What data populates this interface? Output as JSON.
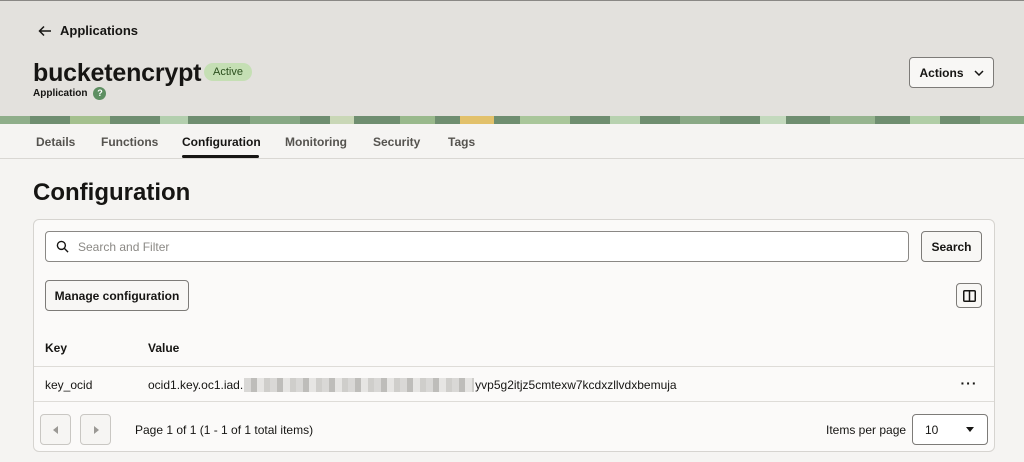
{
  "header": {
    "back_label": "Applications",
    "title": "bucketencrypt",
    "status": "Active",
    "subtitle": "Application",
    "actions_label": "Actions"
  },
  "tabs": [
    {
      "label": "Details"
    },
    {
      "label": "Functions"
    },
    {
      "label": "Configuration",
      "active": true
    },
    {
      "label": "Monitoring"
    },
    {
      "label": "Security"
    },
    {
      "label": "Tags"
    }
  ],
  "main": {
    "title": "Configuration",
    "search_placeholder": "Search and Filter",
    "search_button": "Search",
    "manage_button": "Manage configuration"
  },
  "table": {
    "columns": [
      "Key",
      "Value"
    ],
    "rows": [
      {
        "key": "key_ocid",
        "value_start": "ocid1.key.oc1.iad.",
        "value_end": "yvp5g2itjz5cmtexw7kcdxzllvdxbemuja"
      }
    ]
  },
  "pagination": {
    "page_info": "Page 1 of 1 (1 - 1 of 1 total items)",
    "items_per_page_label": "Items per page",
    "items_per_page": "10"
  },
  "colors": {
    "status_badge_bg": "#c5dfb4",
    "help_icon": "#5e8f62"
  }
}
